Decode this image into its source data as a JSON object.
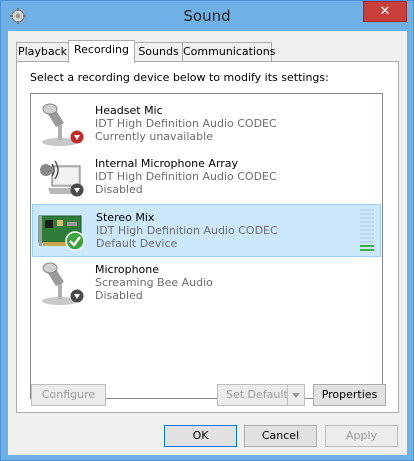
{
  "window": {
    "title": "Sound",
    "close_glyph": "✕"
  },
  "tabs": [
    {
      "label": "Playback"
    },
    {
      "label": "Recording"
    },
    {
      "label": "Sounds"
    },
    {
      "label": "Communications"
    }
  ],
  "panel": {
    "instruction": "Select a recording device below to modify its settings:"
  },
  "devices": [
    {
      "name": "Headset Mic",
      "driver": "IDT High Definition Audio CODEC",
      "status": "Currently unavailable",
      "icon": "headset-mic-icon",
      "badge": "red-down-arrow-badge"
    },
    {
      "name": "Internal Microphone Array",
      "driver": "IDT High Definition Audio CODEC",
      "status": "Disabled",
      "icon": "laptop-microphone-icon",
      "badge": "grey-down-arrow-badge"
    },
    {
      "name": "Stereo Mix",
      "driver": "IDT High Definition Audio CODEC",
      "status": "Default Device",
      "icon": "sound-card-icon",
      "badge": "green-check-badge",
      "level": 0.15
    },
    {
      "name": "Microphone",
      "driver": "Screaming Bee Audio",
      "status": "Disabled",
      "icon": "microphone-icon",
      "badge": "grey-down-arrow-badge"
    }
  ],
  "buttons": {
    "configure": "Configure",
    "set_default": "Set Default",
    "properties": "Properties",
    "ok": "OK",
    "cancel": "Cancel",
    "apply": "Apply"
  },
  "colors": {
    "selection_bg": "#cce8ff",
    "selection_border": "#99d1ff",
    "title_bar": "#6fb0e6",
    "close_button": "#c9403a",
    "level_green": "#3cb043"
  }
}
